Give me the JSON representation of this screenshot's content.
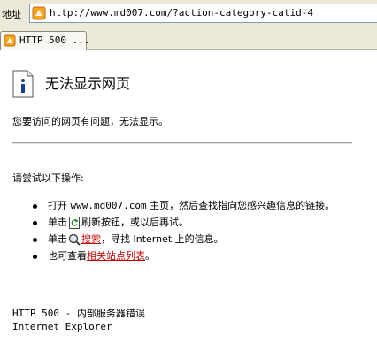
{
  "address_bar": {
    "label": "地址",
    "url": "http://www.md007.com/?action-category-catid-4"
  },
  "tab": {
    "label": "HTTP 500 ..."
  },
  "page": {
    "title": "无法显示网页",
    "subtitle": "您要访问的网页有问题，无法显示。",
    "try_heading": "请尝试以下操作:",
    "items": [
      {
        "prefix": "打开",
        "link": "www.md007.com",
        "suffix": "主页，然后查找指向您感兴趣信息的链接。"
      },
      {
        "prefix": "单击",
        "icon": "refresh-icon",
        "suffix": "刷新按钮，或以后再试。"
      },
      {
        "prefix": "单击",
        "icon": "search-icon",
        "link": "搜索",
        "suffix": "，寻找 Internet 上的信息。"
      },
      {
        "prefix": "也可查看",
        "link": "相关站点列表",
        "suffix": "。"
      }
    ],
    "error_code": "HTTP 500 - 内部服务器错误",
    "browser": "Internet Explorer"
  },
  "colors": {
    "link_red": "#c00000",
    "chrome": "#ece9d8"
  }
}
